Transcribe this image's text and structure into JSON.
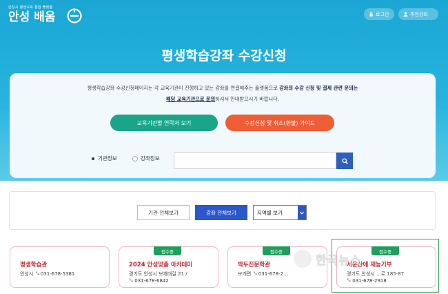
{
  "header": {
    "logo_tagline": "안성시 평생교육 통합 플랫폼",
    "logo_name": "안성 배움",
    "login_label": "로그인",
    "recommend_label": "추천강좌"
  },
  "hero": {
    "title": "평생학습강좌 수강신청"
  },
  "notice": {
    "line1_pre": "평생학습강좌 수강신청페이지는 각 교육기관이 진행하고 있는 강좌를 연결해주는 플랫폼으로 ",
    "line1_bold": "강좌의 수강 신청 및 결제 관련 문의는",
    "line2_ul": "해당 교육기관으로 문의",
    "line2_post": "하셔서 안내받으시기 바랍니다."
  },
  "actions": {
    "contact_label": "교육기관별 연락처 보기",
    "guide_label": "수강신청 및 취소(환불) 가이드"
  },
  "search": {
    "option_org": "기관정보",
    "option_course": "강좌정보",
    "selected": "기관정보",
    "placeholder": ""
  },
  "filters": {
    "all_org": "기관 전체보기",
    "all_course": "강좌 전체보기",
    "region": "지역별 보기"
  },
  "cards": [
    {
      "badge": "",
      "title": "평생학습관",
      "address": "안성시",
      "phone": "031-678-5381"
    },
    {
      "badge": "접수중",
      "title": "2024 안성맞춤 아카데미",
      "address": "경기도 안성시 보개대길 21 /",
      "phone": "031-678-6842"
    },
    {
      "badge": "접수중",
      "title": "박두진문학관",
      "address": "보개면",
      "phone": "031-678-2..."
    },
    {
      "badge": "접수중",
      "title": "서운산에 재능기부",
      "address": "경기도 안성시 ...로 185-87",
      "phone": "031-678-2918"
    }
  ],
  "watermark": "한국뉴스"
}
